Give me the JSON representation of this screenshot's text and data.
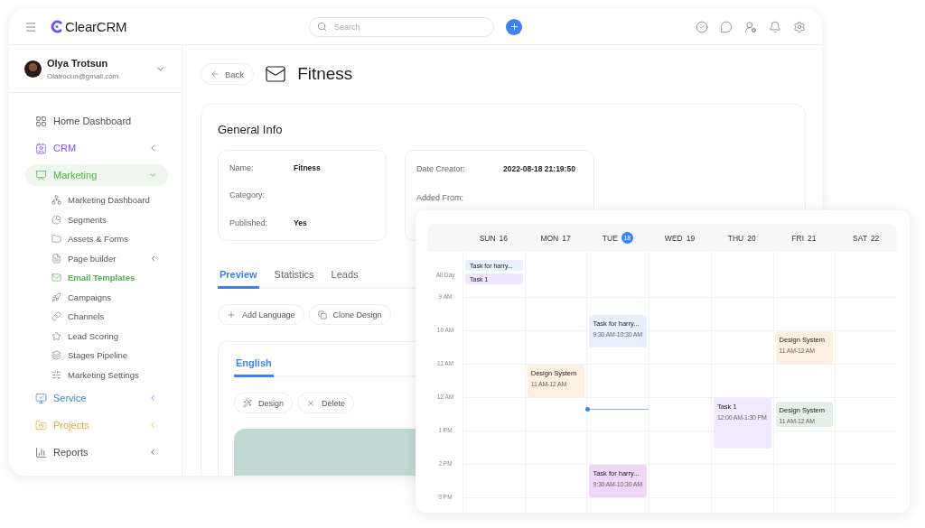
{
  "app": {
    "logo": "ClearCRM",
    "search": {
      "placeholder": "Search"
    }
  },
  "user": {
    "name": "Olya Trotsun",
    "email": "Olatrocun@gmail.com"
  },
  "sidebar": {
    "items": [
      {
        "label": "Home Dashboard",
        "kind": "link",
        "color": "#4a4a4a",
        "selected": false
      },
      {
        "label": "CRM",
        "kind": "group",
        "color": "#8b4dff",
        "selected": false,
        "expanded": false
      },
      {
        "label": "Marketing",
        "kind": "group",
        "color": "#4caf50",
        "selected": true,
        "expanded": true,
        "children": [
          {
            "label": "Marketing Dashboard",
            "kind": "link",
            "selected": false
          },
          {
            "label": "Segments",
            "kind": "link",
            "selected": false
          },
          {
            "label": "Assets & Forms",
            "kind": "link",
            "selected": false
          },
          {
            "label": "Page builder",
            "kind": "group",
            "selected": false,
            "expanded": false
          },
          {
            "label": "Email Templates",
            "kind": "link",
            "selected": true
          },
          {
            "label": "Campaigns",
            "kind": "link",
            "selected": false
          },
          {
            "label": "Channels",
            "kind": "link",
            "selected": false
          },
          {
            "label": "Lead Scoring",
            "kind": "link",
            "selected": false
          },
          {
            "label": "Stages Pipeline",
            "kind": "link",
            "selected": false
          },
          {
            "label": "Marketing Settings",
            "kind": "link",
            "selected": false
          }
        ]
      },
      {
        "label": "Service",
        "kind": "group",
        "color": "#3b82f6",
        "selected": false,
        "expanded": false
      },
      {
        "label": "Projects",
        "kind": "group",
        "color": "#f5a03a",
        "selected": false,
        "expanded": false
      },
      {
        "label": "Reports",
        "kind": "group",
        "color": "#4a4a4a",
        "selected": false,
        "expanded": false
      }
    ]
  },
  "page": {
    "back": "Back",
    "title": "Fitness"
  },
  "general_info": {
    "title": "General Info",
    "left": [
      {
        "label": "Name:",
        "value": "Fitness"
      },
      {
        "label": "Category:"
      },
      {
        "label": "Published:",
        "value": "Yes"
      }
    ],
    "right": [
      {
        "label": "Date Creator:",
        "value": "2022-08-18 21:19:50"
      },
      {
        "label": "Added From:"
      }
    ]
  },
  "tabs": [
    {
      "label": "Preview",
      "selected": true
    },
    {
      "label": "Statistics",
      "selected": false
    },
    {
      "label": "Leads",
      "selected": false
    }
  ],
  "actions": [
    "Add Language",
    "Clone Design"
  ],
  "language_tabs": [
    {
      "label": "English",
      "selected": true
    }
  ],
  "template_actions": [
    "Design",
    "Delete"
  ],
  "calendar": {
    "all_day_label": "All Day",
    "hours": [
      "9 AM",
      "10 AM",
      "11 AM",
      "12 AM",
      "1 PM",
      "2 PM",
      "3 PM"
    ],
    "days": [
      {
        "name": "SUN",
        "date": "16",
        "today": false,
        "all_day": [
          {
            "title": "Task for harry...",
            "color": "#e8f0fe"
          },
          {
            "title": "Task 1",
            "color": "#efe6fd"
          }
        ]
      },
      {
        "name": "MON",
        "date": "17",
        "today": false,
        "events": [
          {
            "title": "Design System",
            "time": "11 AM-12 AM",
            "color": "#fdf0e1"
          }
        ]
      },
      {
        "name": "TUE",
        "date": "18",
        "today": true,
        "events": [
          {
            "title": "Task for harry...",
            "time": "9:30 AM-10:30 AM",
            "color": "#e8f0fe"
          },
          {
            "title": "Task for harry...",
            "time": "9:30 AM-10:30 AM",
            "color": "#efd8f7"
          }
        ]
      },
      {
        "name": "WED",
        "date": "19",
        "today": false
      },
      {
        "name": "THU",
        "date": "20",
        "today": false,
        "events": [
          {
            "title": "Task 1",
            "time": "12:00 AM-1:30 PM",
            "color": "#f1eafe"
          }
        ]
      },
      {
        "name": "FRI",
        "date": "21",
        "today": false,
        "events": [
          {
            "title": "Design System",
            "time": "11 AM-12 AM",
            "color": "#fdf0e1"
          },
          {
            "title": "Design System",
            "time": "11 AM-12 AM",
            "color": "#e4f0e5"
          }
        ]
      },
      {
        "name": "SAT",
        "date": "22",
        "today": false
      }
    ]
  }
}
